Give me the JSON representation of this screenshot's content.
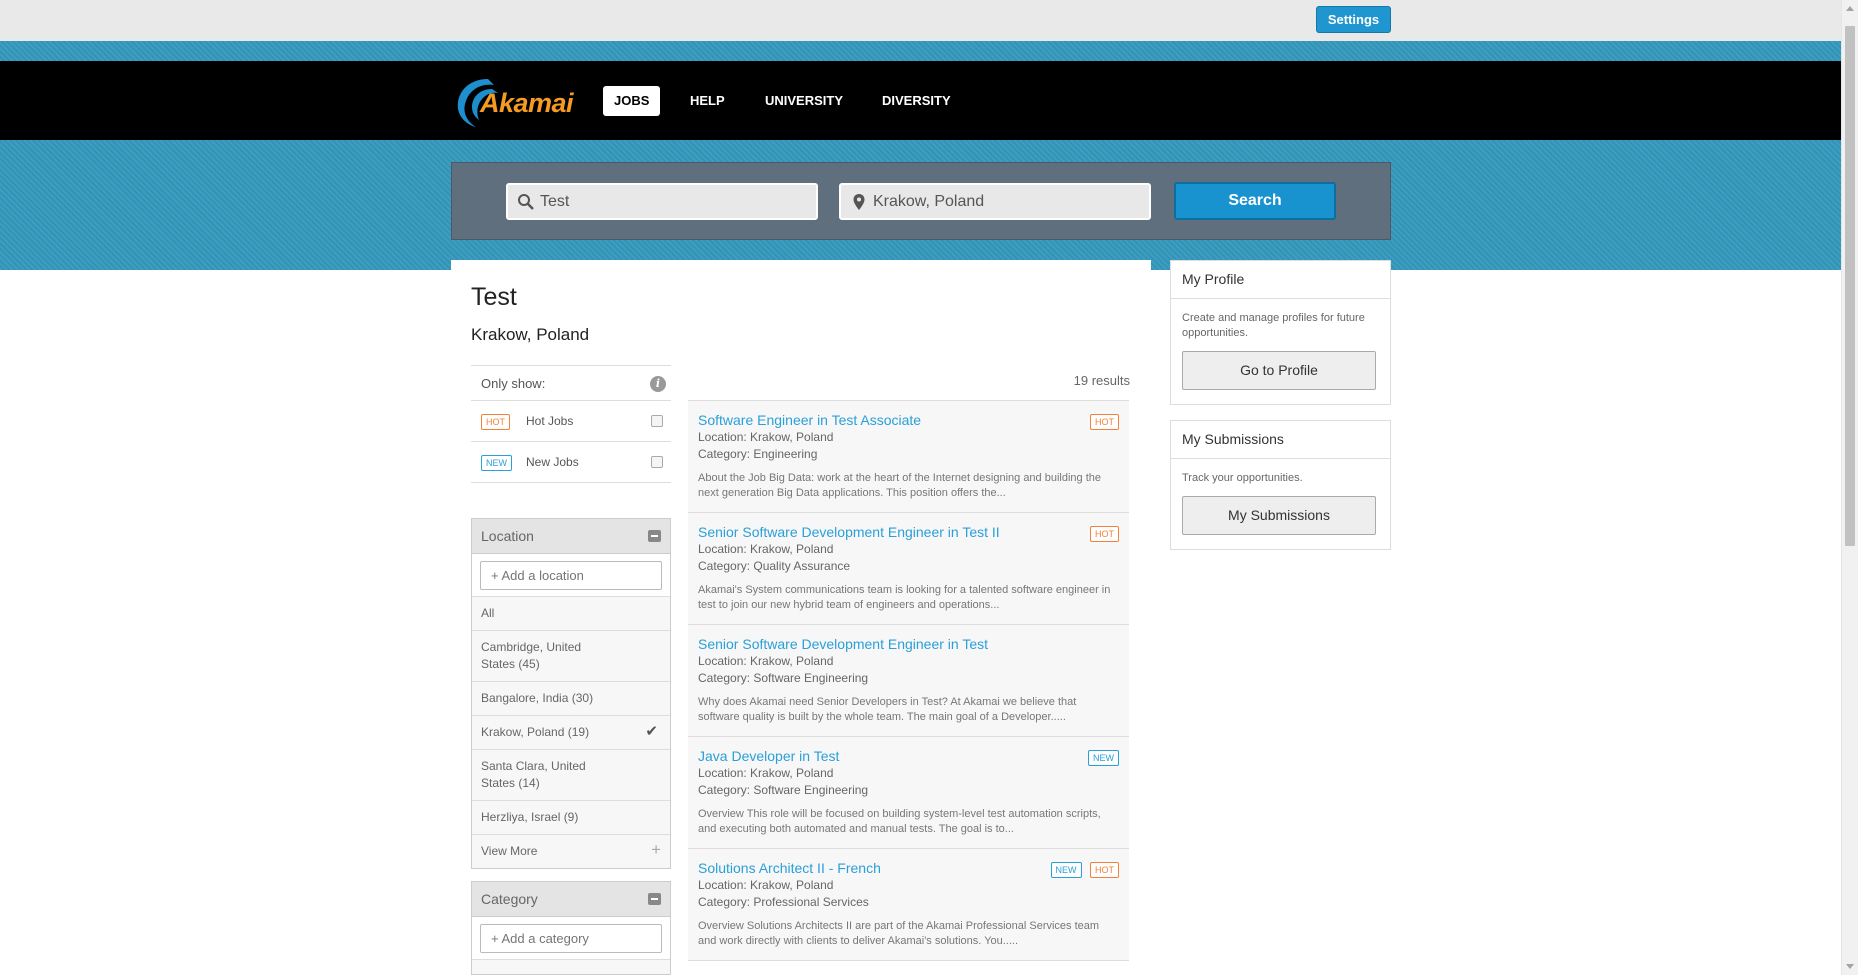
{
  "topbar": {
    "settings_label": "Settings"
  },
  "nav": {
    "logo_text": "Akamai",
    "items": [
      {
        "label": "JOBS",
        "active": true
      },
      {
        "label": "HELP",
        "active": false
      },
      {
        "label": "UNIVERSITY",
        "active": false
      },
      {
        "label": "DIVERSITY",
        "active": false
      }
    ]
  },
  "search": {
    "keyword_value": "Test",
    "location_value": "Krakow, Poland",
    "button_label": "Search"
  },
  "results_header": {
    "title": "Test",
    "location": "Krakow, Poland",
    "count_text": "19 results"
  },
  "only_show": {
    "label": "Only show:",
    "options": [
      {
        "tag": "HOT",
        "label": "Hot Jobs",
        "checked": false
      },
      {
        "tag": "NEW",
        "label": "New Jobs",
        "checked": false
      }
    ]
  },
  "location_facet": {
    "title": "Location",
    "add_placeholder": "+ Add a location",
    "items": [
      "All",
      "Cambridge, United States (45)",
      "Bangalore, India (30)",
      "Krakow, Poland (19)",
      "Santa Clara, United States (14)",
      "Herzliya, Israel (9)"
    ],
    "selected": "Krakow, Poland (19)",
    "view_more": "View More"
  },
  "category_facet": {
    "title": "Category",
    "add_placeholder": "+ Add a category"
  },
  "jobs": [
    {
      "title": "Software Engineer in Test Associate",
      "location": "Location: Krakow, Poland",
      "category": "Category: Engineering",
      "description": "About the Job Big Data: work at the heart of the Internet designing and building the next generation Big Data applications. This position offers the...",
      "tags": [
        "HOT"
      ]
    },
    {
      "title": "Senior Software Development Engineer in Test II",
      "location": "Location: Krakow, Poland",
      "category": "Category: Quality Assurance",
      "description": "Akamai's System communications team is looking for a talented software engineer in test to join our new hybrid team of engineers and operations...",
      "tags": [
        "HOT"
      ]
    },
    {
      "title": "Senior Software Development Engineer in Test",
      "location": "Location: Krakow, Poland",
      "category": "Category: Software Engineering",
      "description": "Why does Akamai need Senior Developers in Test? At Akamai we believe that software quality is built by the whole team. The main goal of a Developer.....",
      "tags": []
    },
    {
      "title": "Java Developer in Test",
      "location": "Location: Krakow, Poland",
      "category": "Category: Software Engineering",
      "description": "Overview This role will be focused on building system-level test automation scripts, and executing both automated and manual tests. The goal is to...",
      "tags": [
        "NEW"
      ]
    },
    {
      "title": "Solutions Architect II - French",
      "location": "Location: Krakow, Poland",
      "category": "Category: Professional Services",
      "description": "Overview Solutions Architects II are part of the Akamai Professional Services team and work directly with clients to deliver Akamai's solutions. You.....",
      "tags": [
        "NEW",
        "HOT"
      ]
    }
  ],
  "sidebar": {
    "profile": {
      "title": "My Profile",
      "text": "Create and manage profiles for future opportunities.",
      "button_label": "Go to Profile"
    },
    "submissions": {
      "title": "My Submissions",
      "text": "Track your opportunities.",
      "button_label": "My Submissions"
    }
  },
  "colors": {
    "brand_blue": "#1893d0",
    "logo_orange": "#f59a23",
    "hot_tag": "#f2813a",
    "new_tag": "#2aa0d8",
    "band_blue": "#3499bd"
  }
}
